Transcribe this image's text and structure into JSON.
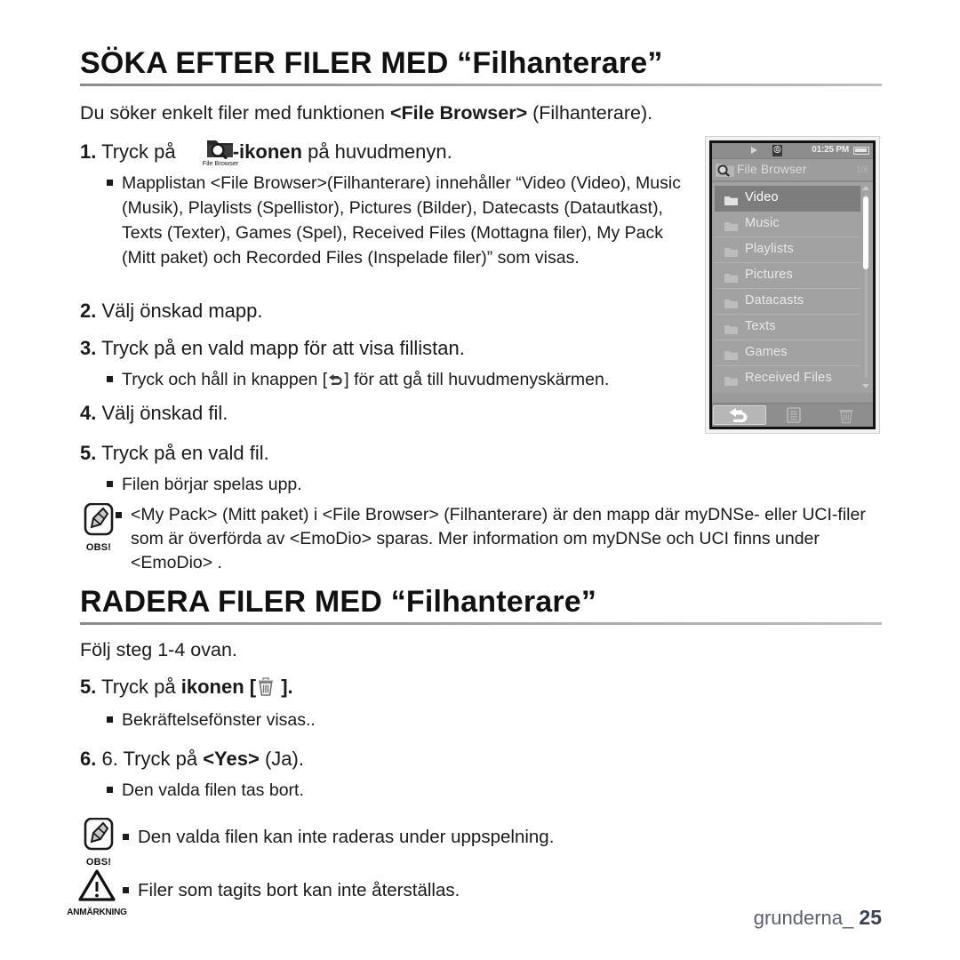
{
  "document": {
    "language": "sv",
    "footer": {
      "chapter": "grunderna",
      "separator": "_",
      "page_number": "25"
    }
  },
  "section1": {
    "heading": "SÖKA EFTER FILER MED “Filhanterare”",
    "intro_a": "Du söker enkelt filer med funktionen ",
    "intro_bold": "<File Browser>",
    "intro_b": " (Filhanterare).",
    "steps": [
      {
        "num": "1.",
        "text_a": "Tryck på",
        "icon_label": "File Browser",
        "text_bold": "-ikonen",
        "text_b": " på huvudmenyn.",
        "bullets": [
          "Mapplistan <File Browser>(Filhanterare) innehåller “Video (Video), Music (Musik), Playlists (Spellistor), Pictures (Bilder), Datecasts (Datautkast), Texts (Texter), Games (Spel), Received Files (Mottagna filer), My Pack (Mitt paket) och Recorded Files (Inspelade filer)” som visas."
        ]
      },
      {
        "num": "2.",
        "text": "Välj önskad mapp.",
        "bullets": []
      },
      {
        "num": "3.",
        "text": "Tryck på en vald mapp för att visa fillistan.",
        "bullets": [
          {
            "before": "Tryck och håll in knappen [",
            "icon": "back-arrow-icon",
            "after": "] för att gå till huvudmenyskärmen."
          }
        ]
      },
      {
        "num": "4.",
        "text": "Välj önskad fil.",
        "bullets": []
      },
      {
        "num": "5.",
        "text": "Tryck på en vald fil.",
        "bullets": [
          "Filen börjar spelas upp."
        ]
      }
    ],
    "note": {
      "icon_label": "OBS!",
      "text": "<My Pack> (Mitt paket) i <File Browser> (Filhanterare) är den mapp där myDNSe- eller UCI-filer som är överförda av <EmoDio> sparas. Mer information om myDNSe och UCI finns under <EmoDio> ."
    }
  },
  "section2": {
    "heading": "RADERA FILER MED “Filhanterare”",
    "intro": "Följ steg 1-4 ovan.",
    "steps": [
      {
        "num": "5.",
        "text_a": "Tryck på ",
        "text_bold": "ikonen",
        "bracket_open": " [",
        "icon": "trash-icon",
        "bracket_close": " ].",
        "bullets": [
          "Bekräftelsefönster visas.."
        ]
      },
      {
        "num": "6.",
        "text_a": "6. Tryck på ",
        "text_bold": "<Yes>",
        "text_b": " (Ja).",
        "bullets": [
          "Den valda filen tas bort."
        ]
      }
    ],
    "notes": [
      {
        "icon_label": "OBS!",
        "icon_type": "note-pen-icon",
        "text": "Den valda filen kan inte raderas under uppspelning."
      },
      {
        "icon_label": "ANMÄRKNING",
        "icon_type": "warning-triangle-icon",
        "text": "Filer som tagits bort kan inte återställas."
      }
    ]
  },
  "device_screen": {
    "status_bar": {
      "play_icon": "play-icon",
      "bluetooth_icon": "bluetooth-icon",
      "time": "01:25 PM",
      "battery_icon": "battery-full-icon"
    },
    "title_bar": {
      "icon": "file-browser-icon",
      "title": "File Browser",
      "page_indicator": "1/8"
    },
    "items": [
      {
        "label": "Video",
        "selected": true
      },
      {
        "label": "Music",
        "selected": false
      },
      {
        "label": "Playlists",
        "selected": false
      },
      {
        "label": "Pictures",
        "selected": false
      },
      {
        "label": "Datacasts",
        "selected": false
      },
      {
        "label": "Texts",
        "selected": false
      },
      {
        "label": "Games",
        "selected": false
      },
      {
        "label": "Received Files",
        "selected": false
      }
    ],
    "toolbar": [
      {
        "icon": "back-arrow-icon",
        "active": true
      },
      {
        "icon": "list-menu-icon",
        "active": false
      },
      {
        "icon": "trash-icon",
        "active": false
      }
    ],
    "colors": {
      "screen_bg": "#a2a2a2",
      "status_bg": "#8d8d8d",
      "selected_row": "#7d7d7d",
      "text": "#e8e8e8"
    }
  }
}
